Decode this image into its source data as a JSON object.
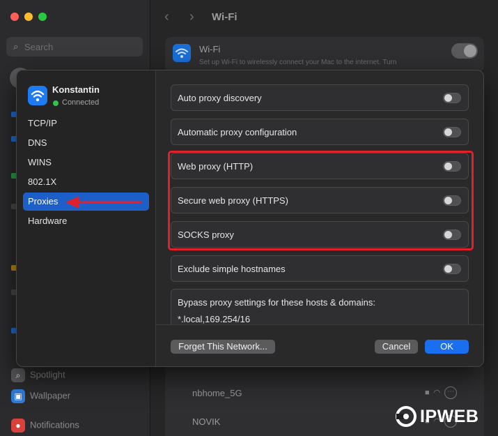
{
  "background": {
    "search_placeholder": "Search",
    "title": "Wi-Fi",
    "wifi_name": "Wi-Fi",
    "wifi_desc": "Set up Wi-Fi to wirelessly connect your Mac to the internet. Turn",
    "sidebar_items": [
      {
        "label": "Spotlight",
        "icon": "magnifier-icon",
        "color": "#5a5a5c"
      },
      {
        "label": "Wallpaper",
        "icon": "wallpaper-icon",
        "color": "#2f7bd9"
      },
      {
        "label": "Notifications",
        "icon": "bell-icon",
        "color": "#d9423a"
      }
    ],
    "networks": [
      {
        "name": "nbhome_5G"
      },
      {
        "name": "NOVIK"
      }
    ],
    "more_glyph": "⋯"
  },
  "sheet": {
    "network_name": "Konstantin",
    "network_status": "Connected",
    "sidebar": [
      {
        "label": "TCP/IP"
      },
      {
        "label": "DNS"
      },
      {
        "label": "WINS"
      },
      {
        "label": "802.1X"
      },
      {
        "label": "Proxies",
        "selected": true
      },
      {
        "label": "Hardware"
      }
    ],
    "proxy_rows": [
      {
        "label": "Auto proxy discovery",
        "enabled": false
      },
      {
        "label": "Automatic proxy configuration",
        "enabled": false
      },
      {
        "label": "Web proxy (HTTP)",
        "enabled": false
      },
      {
        "label": "Secure web proxy (HTTPS)",
        "enabled": false
      },
      {
        "label": "SOCKS proxy",
        "enabled": false
      },
      {
        "label": "Exclude simple hostnames",
        "enabled": false
      }
    ],
    "bypass": {
      "label": "Bypass proxy settings for these hosts & domains:",
      "value": "*.local,169.254/16"
    },
    "buttons": {
      "forget": "Forget This Network...",
      "cancel": "Cancel",
      "ok": "OK"
    }
  },
  "annotations": {
    "highlight_color": "#e0202a"
  },
  "watermark": {
    "text": "IPWEB"
  }
}
